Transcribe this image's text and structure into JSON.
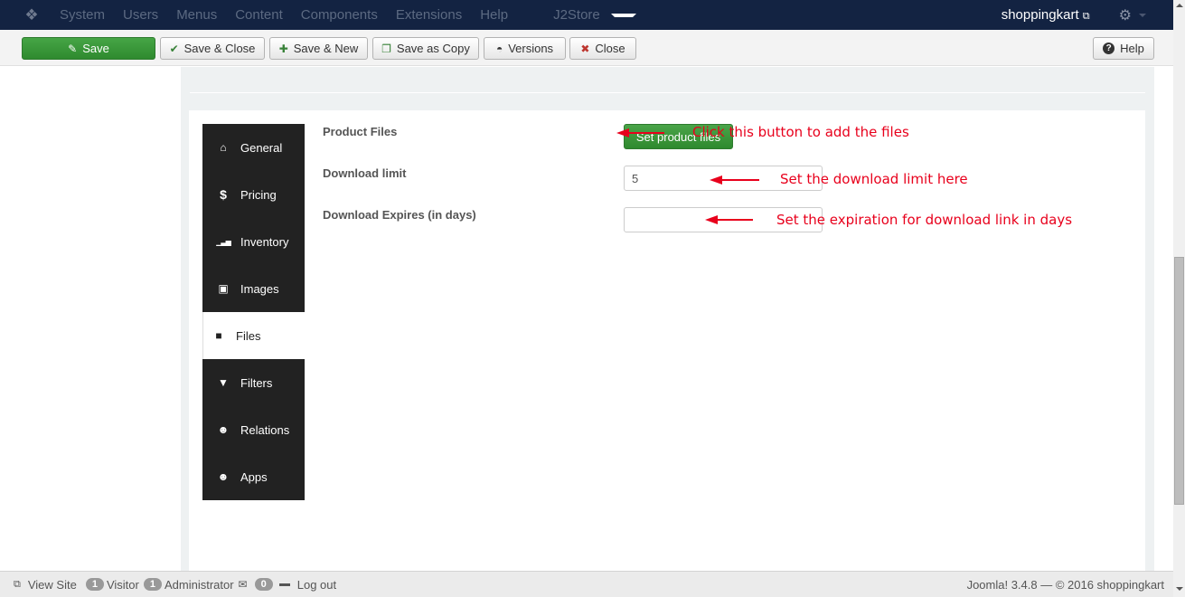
{
  "navbar": {
    "logo_icon": "joomla-logo-icon",
    "menu": [
      "System",
      "Users",
      "Menus",
      "Content",
      "Components",
      "Extensions",
      "Help"
    ],
    "active_menu": "J2Store",
    "site_name": "shoppingkart",
    "external_icon": "⧉",
    "gear_icon": "⚙"
  },
  "toolbar": {
    "save": "Save",
    "save_close": "Save & Close",
    "save_new": "Save & New",
    "save_copy": "Save as Copy",
    "versions": "Versions",
    "close": "Close",
    "help": "Help",
    "icons": {
      "save": "✎",
      "save_close": "✔",
      "save_new": "✚",
      "save_copy": "❐",
      "versions": "◓",
      "close": "✖",
      "help": "?"
    }
  },
  "tabs": [
    {
      "label": "General",
      "icon": "⌂",
      "active": false
    },
    {
      "label": "Pricing",
      "icon": "$",
      "active": false
    },
    {
      "label": "Inventory",
      "icon": "▁▃▅",
      "active": false
    },
    {
      "label": "Images",
      "icon": "▣",
      "active": false
    },
    {
      "label": "Files",
      "icon": "■",
      "active": true
    },
    {
      "label": "Filters",
      "icon": "▼",
      "active": false
    },
    {
      "label": "Relations",
      "icon": "☻",
      "active": false
    },
    {
      "label": "Apps",
      "icon": "☻",
      "active": false
    }
  ],
  "form": {
    "product_files_label": "Product Files",
    "set_files_button": "Set product files",
    "download_limit_label": "Download limit",
    "download_limit_value": "5",
    "download_expires_label": "Download Expires (in days)",
    "download_expires_value": ""
  },
  "annotations": {
    "note1": "Click this button to add the files",
    "note2": "Set the download limit here",
    "note3": "Set the expiration for download link in days",
    "color": "#e8001c"
  },
  "status": {
    "view_site": "View Site",
    "visitor_count": "1",
    "visitor_label": "Visitor",
    "admin_count": "1",
    "admin_label": "Administrator",
    "message_count": "0",
    "logout": "Log out",
    "footer": "Joomla! 3.4.8  —  © 2016 shoppingkart"
  }
}
